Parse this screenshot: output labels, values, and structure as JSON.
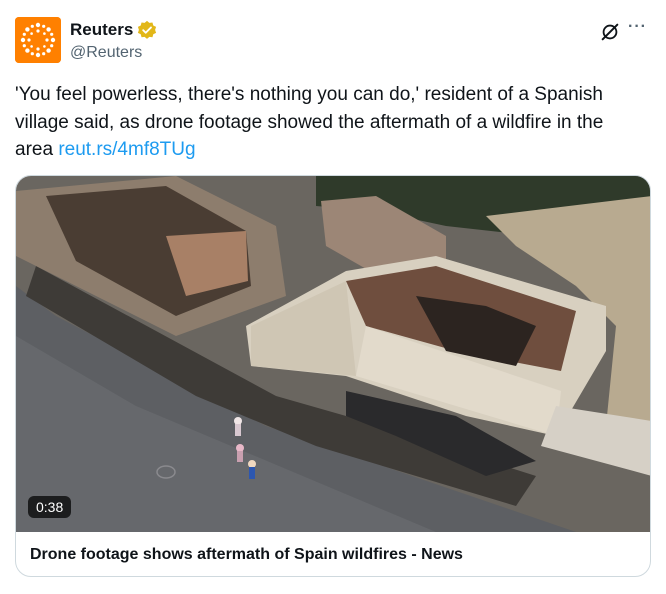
{
  "author": {
    "display_name": "Reuters",
    "handle": "@Reuters",
    "avatar_icon": "reuters-logo-icon",
    "verified_icon": "verified-badge-icon",
    "brand_color": "#ff8000",
    "verified_color": "#e2b719"
  },
  "actions": {
    "grok_icon": "grok-icon",
    "more_label": "···"
  },
  "tweet": {
    "text": "'You feel powerless, there's nothing you can do,' resident of a Spanish village said, as drone footage showed the aftermath of a wildfire in the area ",
    "link": "reut.rs/4mf8TUg",
    "link_color": "#1d9bf0"
  },
  "media": {
    "duration": "0:38",
    "caption": "Drone footage shows aftermath of Spain wildfires - News",
    "image_subject": "drone-photo"
  }
}
